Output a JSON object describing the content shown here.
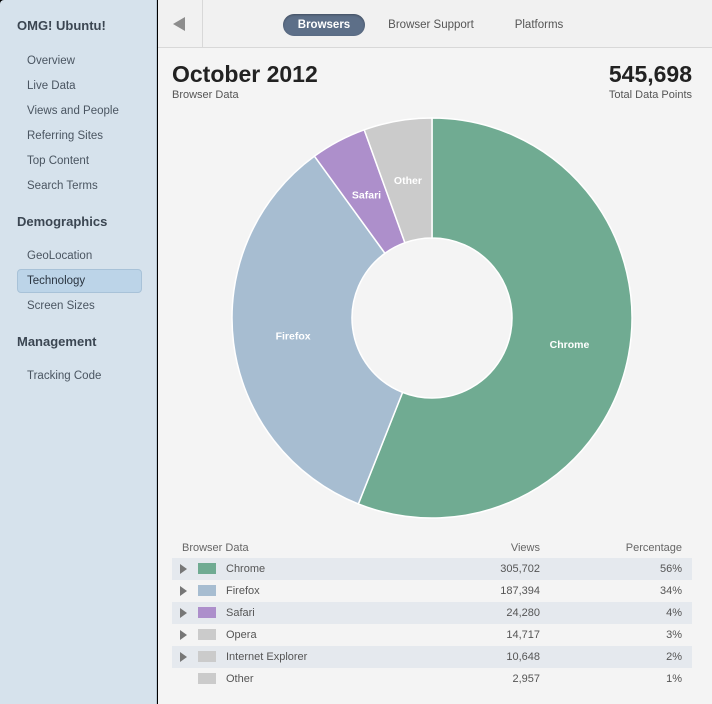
{
  "sidebar": {
    "app_title": "OMG! Ubuntu!",
    "items": [
      {
        "label": "Overview"
      },
      {
        "label": "Live Data"
      },
      {
        "label": "Views and People"
      },
      {
        "label": "Referring Sites"
      },
      {
        "label": "Top Content"
      },
      {
        "label": "Search Terms"
      }
    ],
    "sections": [
      {
        "title": "Demographics",
        "items": [
          {
            "label": "GeoLocation"
          },
          {
            "label": "Technology"
          },
          {
            "label": "Screen Sizes"
          }
        ]
      },
      {
        "title": "Management",
        "items": [
          {
            "label": "Tracking Code"
          }
        ]
      }
    ]
  },
  "tabs": [
    "Browsers",
    "Browser Support",
    "Platforms"
  ],
  "active_tab": "Browsers",
  "header": {
    "period": "October 2012",
    "period_sub": "Browser Data",
    "total": "545,698",
    "total_sub": "Total Data Points"
  },
  "chart_data": {
    "type": "pie",
    "donut": true,
    "slices": [
      {
        "label": "Chrome",
        "value": 56,
        "color": "#70ab92"
      },
      {
        "label": "Firefox",
        "value": 34,
        "color": "#a7bdd1"
      },
      {
        "label": "Safari",
        "value": 4.5,
        "color": "#ad8fcb"
      },
      {
        "label": "Other",
        "value": 5.5,
        "color": "#cbcbcb"
      }
    ]
  },
  "table": {
    "headers": {
      "name": "Browser Data",
      "views": "Views",
      "pct": "Percentage"
    },
    "rows": [
      {
        "name": "Chrome",
        "views": "305,702",
        "pct": "56%",
        "color": "#70ab92",
        "expandable": true
      },
      {
        "name": "Firefox",
        "views": "187,394",
        "pct": "34%",
        "color": "#a7bdd1",
        "expandable": true
      },
      {
        "name": "Safari",
        "views": "24,280",
        "pct": "4%",
        "color": "#ad8fcb",
        "expandable": true
      },
      {
        "name": "Opera",
        "views": "14,717",
        "pct": "3%",
        "color": "#cbcbcb",
        "expandable": true
      },
      {
        "name": "Internet Explorer",
        "views": "10,648",
        "pct": "2%",
        "color": "#cbcbcb",
        "expandable": true
      },
      {
        "name": "Other",
        "views": "2,957",
        "pct": "1%",
        "color": "#cbcbcb",
        "expandable": false
      }
    ]
  }
}
